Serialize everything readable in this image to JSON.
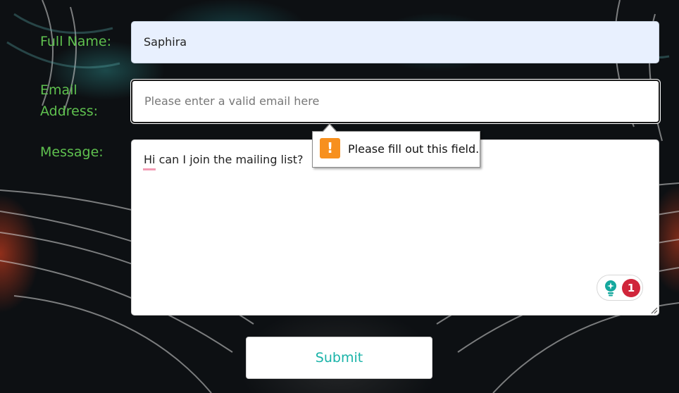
{
  "form": {
    "full_name_label": "Full Name:",
    "full_name_value": "Saphira",
    "email_label_line1": "Email",
    "email_label_line2": "Address:",
    "email_placeholder": "Please enter a valid email here",
    "message_label": "Message:",
    "message_value": "Hi can I join the mailing list?",
    "submit_label": "Submit"
  },
  "validation_tooltip": {
    "icon": "warning-icon",
    "icon_glyph": "!",
    "text": "Please fill out this field."
  },
  "grammar_widget": {
    "icon": "lightbulb-icon",
    "issue_count": "1"
  },
  "colors": {
    "label_green": "#5fc14f",
    "submit_teal": "#19b3a8",
    "warning_orange": "#f7901e",
    "badge_red": "#d0253a",
    "autofill_blue": "#e8f0fe"
  }
}
